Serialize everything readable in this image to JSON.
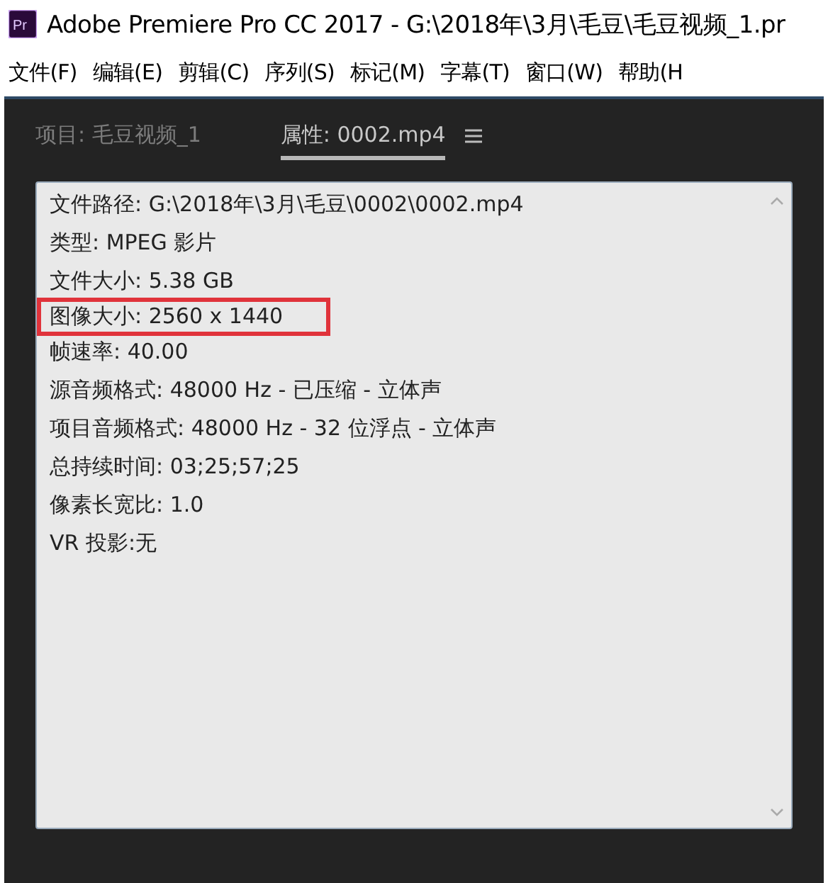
{
  "window": {
    "logo": "Pr",
    "title": "Adobe Premiere Pro CC 2017 - G:\\2018年\\3月\\毛豆\\毛豆视频_1.pr"
  },
  "menu": [
    "文件(F)",
    "编辑(E)",
    "剪辑(C)",
    "序列(S)",
    "标记(M)",
    "字幕(T)",
    "窗口(W)",
    "帮助(H"
  ],
  "tabs": [
    {
      "label": "项目: 毛豆视频_1",
      "selected": false
    },
    {
      "label": "属性: 0002.mp4",
      "selected": true
    }
  ],
  "properties": [
    {
      "text": "文件路径: G:\\2018年\\3月\\毛豆\\0002\\0002.mp4",
      "highlighted": false
    },
    {
      "text": "类型: MPEG 影片",
      "highlighted": false
    },
    {
      "text": "文件大小: 5.38 GB",
      "highlighted": false
    },
    {
      "text": "图像大小: 2560 x 1440",
      "highlighted": true
    },
    {
      "text": "帧速率: 40.00",
      "highlighted": false
    },
    {
      "text": "源音频格式: 48000 Hz - 已压缩 - 立体声",
      "highlighted": false
    },
    {
      "text": "项目音频格式: 48000 Hz - 32 位浮点 - 立体声",
      "highlighted": false
    },
    {
      "text": "总持续时间: 03;25;57;25",
      "highlighted": false
    },
    {
      "text": "像素长宽比: 1.0",
      "highlighted": false
    },
    {
      "text": "VR 投影:无",
      "highlighted": false
    }
  ]
}
